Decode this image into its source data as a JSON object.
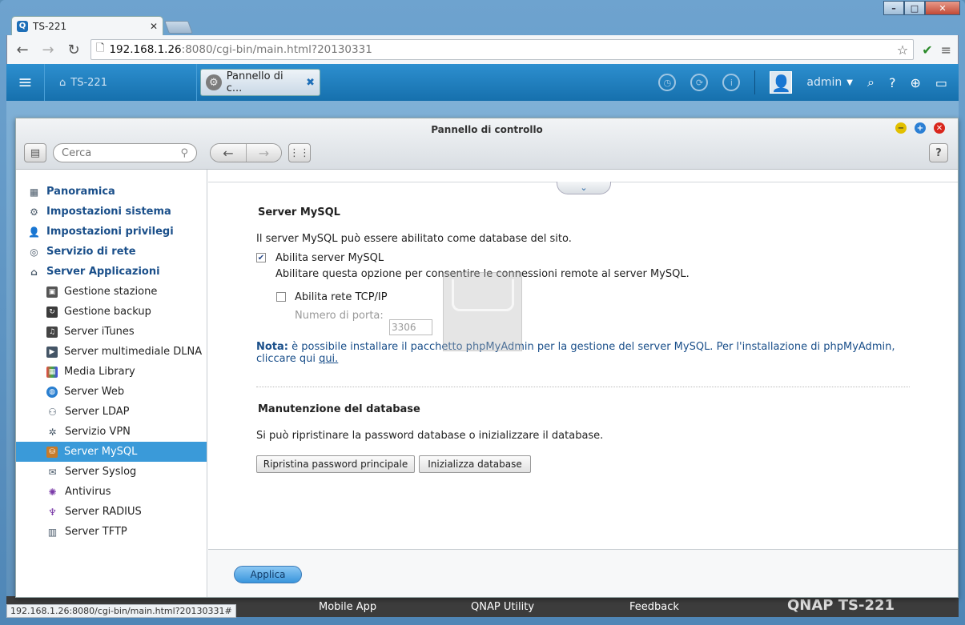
{
  "browser": {
    "tab_title": "TS-221",
    "url_host": "192.168.1.26",
    "url_path": ":8080/cgi-bin/main.html?20130331",
    "status_url": "192.168.1.26:8080/cgi-bin/main.html?20130331#"
  },
  "qnap_bar": {
    "home_label": "TS-221",
    "app_tab_label": "Pannello di c...",
    "user": "admin"
  },
  "window": {
    "title": "Pannello di controllo",
    "search_placeholder": "Cerca"
  },
  "sidebar": {
    "categories": [
      {
        "label": "Panoramica"
      },
      {
        "label": "Impostazioni sistema"
      },
      {
        "label": "Impostazioni privilegi"
      },
      {
        "label": "Servizio di rete"
      },
      {
        "label": "Server Applicazioni"
      }
    ],
    "items": [
      {
        "label": "Gestione stazione"
      },
      {
        "label": "Gestione backup"
      },
      {
        "label": "Server iTunes"
      },
      {
        "label": "Server multimediale DLNA"
      },
      {
        "label": "Media Library"
      },
      {
        "label": "Server Web"
      },
      {
        "label": "Server LDAP"
      },
      {
        "label": "Servizio VPN"
      },
      {
        "label": "Server MySQL"
      },
      {
        "label": "Server Syslog"
      },
      {
        "label": "Antivirus"
      },
      {
        "label": "Server RADIUS"
      },
      {
        "label": "Server TFTP"
      }
    ]
  },
  "mysql": {
    "section_title": "Server MySQL",
    "intro": "Il server MySQL può essere abilitato come database del sito.",
    "enable_label": "Abilita server MySQL",
    "enable_checked": true,
    "enable_desc": "Abilitare questa opzione per consentire le connessioni remote al server MySQL.",
    "tcp_label": "Abilita rete TCP/IP",
    "tcp_checked": false,
    "port_label": "Numero di porta:",
    "port_value": "3306",
    "note_prefix": "Nota:",
    "note_text": " è possibile installare il pacchetto phpMyAdmin per la gestione del server MySQL. Per l'installazione di phpMyAdmin, cliccare qui ",
    "note_link": "qui."
  },
  "maintenance": {
    "section_title": "Manutenzione del database",
    "desc": "Si può ripristinare la password database o inizializzare il database.",
    "reset_button": "Ripristina password principale",
    "init_button": "Inizializza database"
  },
  "footer": {
    "apply_button": "Applica"
  },
  "taskbar": {
    "item1": "Mobile App",
    "item2": "QNAP Utility",
    "item3": "Feedback",
    "brand": "QNAP TS-221"
  }
}
